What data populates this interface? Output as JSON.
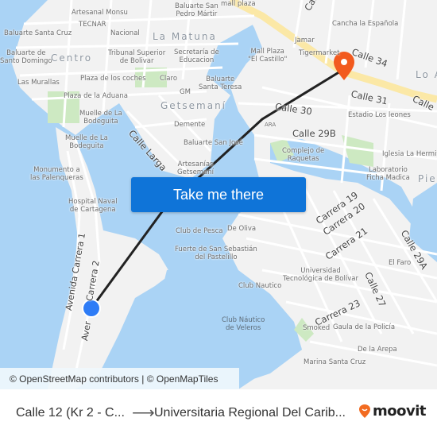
{
  "map": {
    "labels": {
      "artesanal_monsu": "Artesanal Monsu",
      "tecnar": "TECNAR",
      "nacional": "Nacional",
      "baluarte_santa_cruz": "Baluarte Santa Cruz",
      "baluarte_santo_domingo": "Baluarte de\nSanto Domingo",
      "centro": "Centro",
      "tribunal": "Tribunal Superior\nde Bolivar",
      "la_matuna": "La Matuna",
      "secretaria": "Secretaría de\nEducacion",
      "baluarte_san_pedro": "Baluarte San\nPedro Mártir",
      "las_murallas": "Las Murallas",
      "plaza_coches": "Plaza de los coches",
      "claro": "Claro",
      "plaza_aduana": "Plaza de la Aduana",
      "gm": "GM",
      "baluarte_santa_teresa": "Baluarte\nSanta Teresa",
      "getsemani": "Getsemaní",
      "muelle1": "Muelle de La\nBodeguita",
      "muelle2": "Muelle de La\nBodeguita",
      "calle_larga": "Calle Larga",
      "demente": "Demente",
      "baluarte_san_jose": "Baluarte San José",
      "artesanias": "Artesanías\nGetsemaní",
      "monumento": "Monumento a\nlas Palenqueras",
      "hospital": "Hospital Naval\nde Cartagena",
      "mall_plaza_top": "mall plaza",
      "jamar": "Jamar",
      "mall_plaza_castillo": "Mall Plaza\n\"El Castillo\"",
      "tigermarket": "Tigermarket",
      "cancha": "Cancha la Española",
      "calle_34": "Calle 34",
      "lo_a": "Lo A",
      "calle_31": "Calle 31",
      "calle_31b": "Calle",
      "calle_30": "Calle 30",
      "estadio": "Estadio Los leones",
      "calle_29b": "Calle 29B",
      "ara": "ARA",
      "complejo": "Complejo de\nRaquetas",
      "iglesia": "Iglesia La Hermita",
      "laboratorio": "Laboratorio\nFicha Madica",
      "pie": "Pie",
      "carrera_19": "Carrera 19",
      "carrera_20": "Carrera 20",
      "carrera_21": "Carrera 21",
      "carrera_23": "Carrera 23",
      "calle_29a": "Calle 29A",
      "calle_27": "Calle 27",
      "el_faro": "El Faro",
      "club_pesca": "Club de Pesca",
      "de_oliva": "De Oliva",
      "fuerte": "Fuerte de San Sebastián\ndel Pastelillo",
      "universidad": "Universidad\nTecnológica de Bolívar",
      "club_nautico": "Club Nautico",
      "club_veleros": "Club Náutico\nde Veleros",
      "smoked": "Smoked",
      "gaula": "Gaula de la Policía",
      "de_la_arepa": "De la Arepa",
      "marina": "Marina Santa Cruz",
      "avenida_carrera_1": "Avenida Carrera 1",
      "carrera_2": "Carrera 2",
      "avenida_short": "Aver",
      "calle_top": "Calle"
    },
    "take_me_there": "Take me there",
    "attribution": "© OpenStreetMap contributors | © OpenMapTiles",
    "colors": {
      "water": "#aad3f5",
      "land": "#f2f2f2",
      "park": "#cde9c2",
      "major_road": "#fbe8a6",
      "route_line": "#222222",
      "origin_marker": "#2e7cf6",
      "destination_marker": "#f25a1e",
      "button": "#0f74d8"
    }
  },
  "footer": {
    "origin": "Calle 12 (Kr 2 - C...",
    "arrow": "⟶",
    "destination": "Universitaria Regional Del Carib...",
    "brand": "moovit",
    "brand_color": "#f26b21"
  }
}
